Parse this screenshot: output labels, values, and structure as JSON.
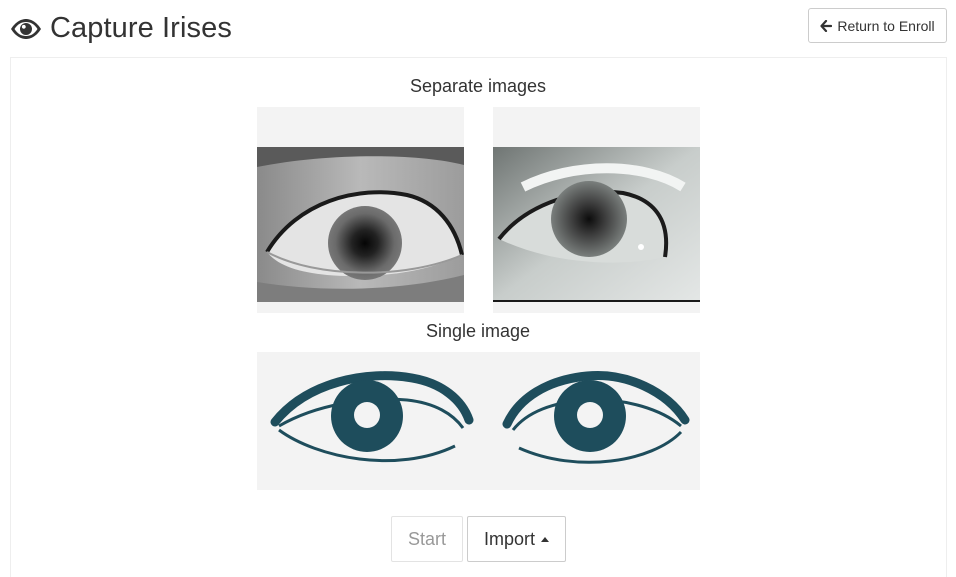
{
  "header": {
    "title": "Capture Irises",
    "title_icon": "eye-icon",
    "return_button_label": "Return to Enroll",
    "return_button_icon": "arrow-left-icon"
  },
  "sections": {
    "separate_label": "Separate images",
    "single_label": "Single image"
  },
  "images": {
    "left_eye": "photo-grayscale-eye-left",
    "right_eye": "photo-grayscale-eye-right",
    "both_eyes": "illustration-two-eyes"
  },
  "buttons": {
    "start_label": "Start",
    "import_label": "Import",
    "import_icon": "caret-up-icon"
  },
  "colors": {
    "eye_illustration": "#1e4d5c",
    "placeholder_bg": "#f3f3f3",
    "disabled_text": "#999999"
  }
}
